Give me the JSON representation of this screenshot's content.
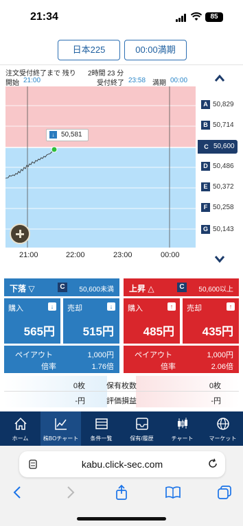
{
  "status_bar": {
    "time": "21:34",
    "battery": "85"
  },
  "selectors": {
    "instrument": "日本225",
    "expiry": "00:00満期"
  },
  "info": {
    "remaining_label": "注文受付終了まで 残り",
    "remaining_value": "2時間 23 分",
    "start_label": "開始",
    "start_time": "21:00",
    "close_label": "受付終了",
    "close_time": "23:58",
    "expiry_label": "満期",
    "expiry_time": "00:00"
  },
  "chart": {
    "current_price": "50,581",
    "x_ticks": [
      "21:00",
      "22:00",
      "23:00",
      "00:00"
    ],
    "levels": [
      {
        "tag": "A",
        "value": "50,829"
      },
      {
        "tag": "B",
        "value": "50,714"
      },
      {
        "tag": "C",
        "value": "50,600"
      },
      {
        "tag": "D",
        "value": "50,486"
      },
      {
        "tag": "E",
        "value": "50,372"
      },
      {
        "tag": "F",
        "value": "50,258"
      },
      {
        "tag": "G",
        "value": "50,143"
      }
    ],
    "selected_level": "C",
    "colors": {
      "above": "#f8c7c9",
      "below": "#b7e0fa"
    }
  },
  "panels": {
    "down": {
      "direction": "下落 ▽",
      "tag": "C",
      "condition": "50,600未満",
      "buy_label": "購入",
      "buy_price": "565円",
      "sell_label": "売却",
      "sell_price": "515円",
      "payout_label": "ペイアウト",
      "payout_value": "1,000円",
      "rate_label": "倍率",
      "rate_value": "1.76倍",
      "color": "#2b7cbf"
    },
    "up": {
      "direction": "上昇 △",
      "tag": "C",
      "condition": "50,600以上",
      "buy_label": "購入",
      "buy_price": "485円",
      "sell_label": "売却",
      "sell_price": "435円",
      "payout_label": "ペイアウト",
      "payout_value": "1,000円",
      "rate_label": "倍率",
      "rate_value": "2.06倍",
      "color": "#d9262c"
    }
  },
  "holdings": {
    "count_label": "保有枚数",
    "down_count": "0枚",
    "up_count": "0枚",
    "pnl_label": "評価損益",
    "down_pnl": "-円",
    "up_pnl": "-円"
  },
  "tabs": [
    {
      "label": "ホーム",
      "icon": "home-icon"
    },
    {
      "label": "株BOチャート",
      "icon": "line-chart-icon",
      "active": true
    },
    {
      "label": "条件一覧",
      "icon": "list-icon"
    },
    {
      "label": "保有/履歴",
      "icon": "tray-icon"
    },
    {
      "label": "チャート",
      "icon": "candlestick-icon"
    },
    {
      "label": "マーケット",
      "icon": "globe-icon"
    }
  ],
  "browser": {
    "url": "kabu.click-sec.com"
  }
}
